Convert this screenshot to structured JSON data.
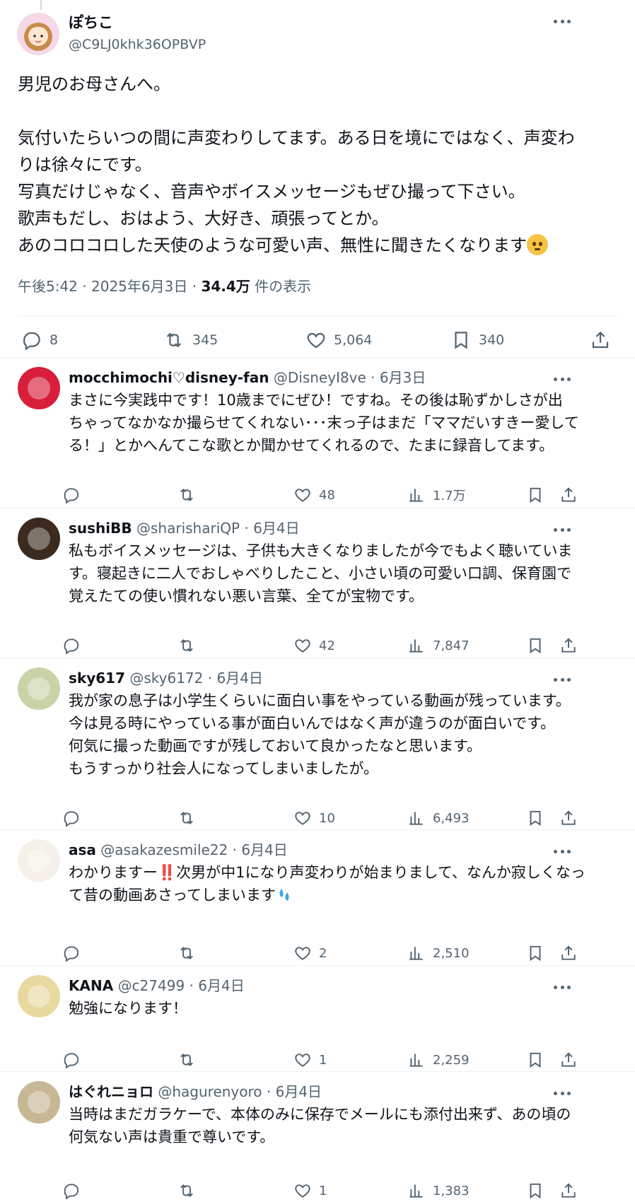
{
  "main_post": {
    "author_name": "ぽちこ",
    "handle": "@C9LJ0khk36OPBVP",
    "text_lines": [
      "男児のお母さんへ。",
      "",
      "気付いたらいつの間に声変わりしてます。ある日を境にではなく、声変わ",
      "りは徐々にです。",
      "写真だけじゃなく、音声やボイスメッセージもぜひ撮って下さい。",
      "歌声もだし、おはよう、大好き、頑張ってとか。",
      "あのコロコロした天使のような可愛い声、無性に聞きたくなります"
    ],
    "emoji": "pleading-face-emoji",
    "time": "午後5:42",
    "sep": " · ",
    "date": "2025年6月3日",
    "views_count": "34.4万",
    "views_label": " 件の表示",
    "replies": "8",
    "reposts": "345",
    "likes": "5,064",
    "bookmarks": "340"
  },
  "replies": [
    {
      "name": "mocchimochi♡disney-fan",
      "handle": "@DisneyI8ve",
      "date": "6月3日",
      "text": "まさに今実践中です！10歳までにぜひ！ですね。その後は恥ずかしさが出\nちゃってなかなか撮らせてくれない･･･末っ子はまだ「ママだいすきー愛して\nる！」とかへんてこな歌とか聞かせてくれるので、たまに録音してます。",
      "likes": "48",
      "views": "1.7万",
      "avatar_color": "#d81e3a"
    },
    {
      "name": "sushiBB",
      "handle": "@sharishariQP",
      "date": "6月4日",
      "text": "私もボイスメッセージは、子供も大きくなりましたが今でもよく聴いていま\nす。寝起きに二人でおしゃべりしたこと、小さい頃の可愛い口調、保育園で\n覚えたての使い慣れない悪い言葉、全てが宝物です。",
      "likes": "42",
      "views": "7,847",
      "avatar_color": "#3b2a1e"
    },
    {
      "name": "sky617",
      "handle": "@sky6172",
      "date": "6月4日",
      "text": "我が家の息子は小学生くらいに面白い事をやっている動画が残っています。\n今は見る時にやっている事が面白いんではなく声が違うのが面白いです。\n何気に撮った動画ですが残しておいて良かったなと思います。\nもうすっかり社会人になってしまいましたが。",
      "likes": "10",
      "views": "6,493",
      "avatar_color": "#c9d3a8"
    },
    {
      "name": "asa",
      "handle": "@asakazesmile22",
      "date": "6月4日",
      "text": "わかりますー‼️次男が中1になり声変わりが始まりまして、なんか寂しくなっ\nて昔の動画あさってしまいます",
      "emoji": "sweat-droplets-emoji",
      "likes": "2",
      "views": "2,510",
      "avatar_color": "#f5f1ea"
    },
    {
      "name": "KANA",
      "handle": "@c27499",
      "date": "6月4日",
      "text": "勉強になります！",
      "likes": "1",
      "views": "2,259",
      "avatar_color": "#e8d9a0"
    },
    {
      "name": "はぐれニョロ",
      "handle": "@hagurenyoro",
      "date": "6月4日",
      "text": "当時はまだガラケーで、本体のみに保存でメールにも添付出来ず、あの頃の\n何気ない声は貴重で尊いです。",
      "likes": "1",
      "views": "1,383",
      "avatar_color": "#c8b795"
    }
  ],
  "colors": {
    "text": "#0f1419",
    "secondary": "#536471",
    "divider": "#eff3f4"
  }
}
